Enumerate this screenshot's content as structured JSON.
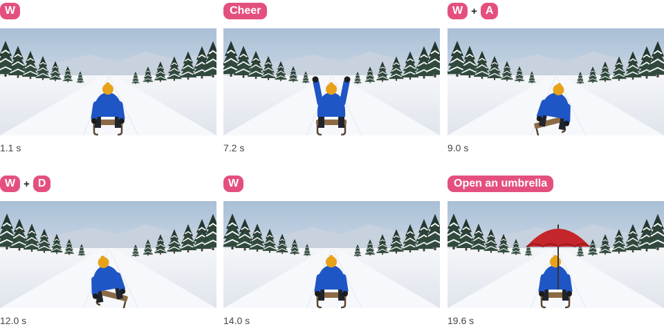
{
  "frames": [
    {
      "keys": [
        "W"
      ],
      "time": "1.1 s",
      "pose": "ride",
      "umbrella": false
    },
    {
      "keys": [
        "Cheer"
      ],
      "time": "7.2 s",
      "pose": "cheer",
      "umbrella": false
    },
    {
      "keys": [
        "W",
        "A"
      ],
      "time": "9.0 s",
      "pose": "left",
      "umbrella": false
    },
    {
      "keys": [
        "W",
        "D"
      ],
      "time": "12.0 s",
      "pose": "right",
      "umbrella": false
    },
    {
      "keys": [
        "W"
      ],
      "time": "14.0 s",
      "pose": "ride",
      "umbrella": false
    },
    {
      "keys": [
        "Open an umbrella"
      ],
      "time": "19.6 s",
      "pose": "ride",
      "umbrella": true
    }
  ],
  "plus_symbol": "+",
  "colors": {
    "tag": "#e4507e",
    "jacket": "#1f56c6",
    "hat": "#e8a21a",
    "umbrella": "#c4262b"
  }
}
